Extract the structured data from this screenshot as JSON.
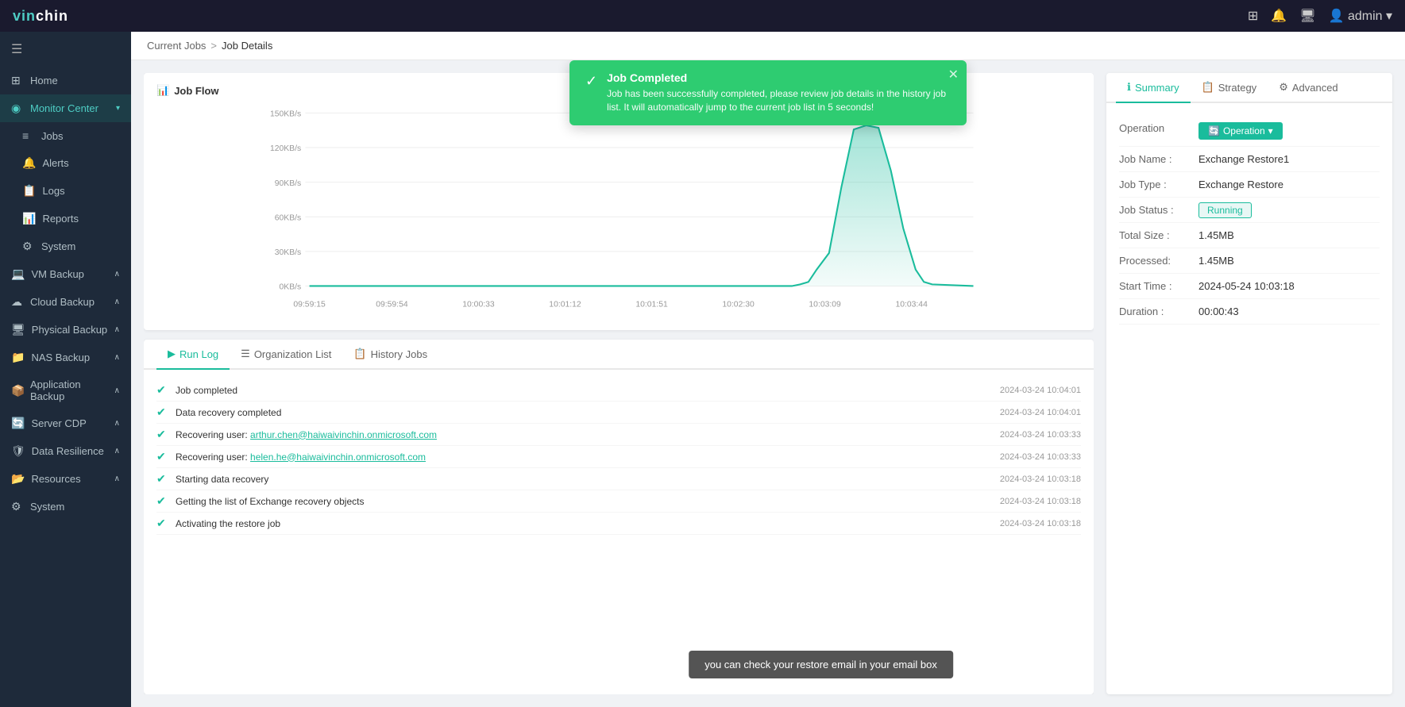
{
  "app": {
    "logo": "vinchin",
    "logo_color": "vin",
    "logo_white": "chin"
  },
  "topbar": {
    "icons": [
      "grid-icon",
      "bell-icon",
      "monitor-icon",
      "user-icon"
    ],
    "user": "admin"
  },
  "sidebar": {
    "hamburger": "☰",
    "items": [
      {
        "id": "home",
        "label": "Home",
        "icon": "⊞",
        "active": false
      },
      {
        "id": "monitor-center",
        "label": "Monitor Center",
        "icon": "◉",
        "active": true,
        "expanded": true
      },
      {
        "id": "jobs",
        "label": "Jobs",
        "icon": "≡",
        "active": false,
        "indent": true
      },
      {
        "id": "alerts",
        "label": "Alerts",
        "icon": "🔔",
        "active": false,
        "indent": true
      },
      {
        "id": "logs",
        "label": "Logs",
        "icon": "📋",
        "active": false,
        "indent": true
      },
      {
        "id": "reports",
        "label": "Reports",
        "icon": "📊",
        "active": false,
        "indent": true
      },
      {
        "id": "system-mc",
        "label": "System",
        "icon": "⚙",
        "active": false,
        "indent": true
      },
      {
        "id": "vm-backup",
        "label": "VM Backup",
        "icon": "💻",
        "active": false,
        "arrow": "∧"
      },
      {
        "id": "cloud-backup",
        "label": "Cloud Backup",
        "icon": "☁",
        "active": false,
        "arrow": "∧"
      },
      {
        "id": "physical-backup",
        "label": "Physical Backup",
        "icon": "🖥",
        "active": false,
        "arrow": "∧"
      },
      {
        "id": "nas-backup",
        "label": "NAS Backup",
        "icon": "📁",
        "active": false,
        "arrow": "∧"
      },
      {
        "id": "application-backup",
        "label": "Application Backup",
        "icon": "📦",
        "active": false,
        "arrow": "∧"
      },
      {
        "id": "server-cdp",
        "label": "Server CDP",
        "icon": "🔄",
        "active": false,
        "arrow": "∧"
      },
      {
        "id": "data-resilience",
        "label": "Data Resilience",
        "icon": "🛡",
        "active": false,
        "arrow": "∧"
      },
      {
        "id": "resources",
        "label": "Resources",
        "icon": "📂",
        "active": false,
        "arrow": "∧"
      },
      {
        "id": "system",
        "label": "System",
        "icon": "⚙",
        "active": false
      }
    ]
  },
  "breadcrumb": {
    "parent": "Current Jobs",
    "separator": ">",
    "current": "Job Details"
  },
  "notification": {
    "title": "Job Completed",
    "message": "Job has been successfully completed, please review job details in the history job list. It will automatically jump to the current job list in 5 seconds!",
    "type": "success"
  },
  "job_flow": {
    "title": "Job Flow",
    "icon": "📊",
    "y_labels": [
      "150KB/s",
      "120KB/s",
      "90KB/s",
      "60KB/s",
      "30KB/s",
      "0KB/s"
    ],
    "x_labels": [
      "09:59:15",
      "09:59:54",
      "10:00:33",
      "10:01:12",
      "10:01:51",
      "10:02:30",
      "10:03:09",
      "10:03:44"
    ]
  },
  "tabs": {
    "items": [
      {
        "id": "run-log",
        "label": "Run Log",
        "icon": "▶",
        "active": true
      },
      {
        "id": "org-list",
        "label": "Organization List",
        "icon": "☰",
        "active": false
      },
      {
        "id": "history-jobs",
        "label": "History Jobs",
        "icon": "📋",
        "active": false
      }
    ]
  },
  "log_items": [
    {
      "id": 1,
      "text": "Job completed",
      "link": null,
      "time": "2024-03-24 10:04:01"
    },
    {
      "id": 2,
      "text": "Data recovery completed",
      "link": null,
      "time": "2024-03-24 10:04:01"
    },
    {
      "id": 3,
      "text": "Recovering user: ",
      "link": "arthur.chen@haiwaivinchin.onmicrosoft.com",
      "link_after": null,
      "time": "2024-03-24 10:03:33"
    },
    {
      "id": 4,
      "text": "Recovering user: ",
      "link": "helen.he@haiwaivinchin.onmicrosoft.com",
      "link_after": null,
      "time": "2024-03-24 10:03:33"
    },
    {
      "id": 5,
      "text": "Starting data recovery",
      "link": null,
      "time": "2024-03-24 10:03:18"
    },
    {
      "id": 6,
      "text": "Getting the list of Exchange recovery objects",
      "link": null,
      "time": "2024-03-24 10:03:18"
    },
    {
      "id": 7,
      "text": "Activating the restore job",
      "link": null,
      "time": "2024-03-24 10:03:18"
    }
  ],
  "summary": {
    "tabs": [
      {
        "id": "summary",
        "label": "Summary",
        "icon": "ℹ",
        "active": true
      },
      {
        "id": "strategy",
        "label": "Strategy",
        "icon": "📋",
        "active": false
      },
      {
        "id": "advanced",
        "label": "Advanced",
        "icon": "⚙",
        "active": false
      }
    ],
    "operation_label": "Operation",
    "operation_btn": "Operation",
    "fields": [
      {
        "label": "Job Name :",
        "value": "Exchange Restore1",
        "id": "job-name"
      },
      {
        "label": "Job Type :",
        "value": "Exchange Restore",
        "id": "job-type"
      },
      {
        "label": "Job Status :",
        "value": "Running",
        "id": "job-status",
        "badge": true
      },
      {
        "label": "Total Size :",
        "value": "1.45MB",
        "id": "total-size"
      },
      {
        "label": "Processed:",
        "value": "1.45MB",
        "id": "processed"
      },
      {
        "label": "Start Time :",
        "value": "2024-05-24 10:03:18",
        "id": "start-time"
      },
      {
        "label": "Duration :",
        "value": "00:00:43",
        "id": "duration"
      }
    ]
  },
  "tooltip": {
    "text": "you can check your restore email in your email box"
  },
  "colors": {
    "primary": "#1abc9c",
    "sidebar_bg": "#1e2a3a",
    "topbar_bg": "#1a1a2e",
    "notification_bg": "#2ecc71",
    "chart_fill": "#a8e6d8",
    "chart_stroke": "#1abc9c"
  }
}
